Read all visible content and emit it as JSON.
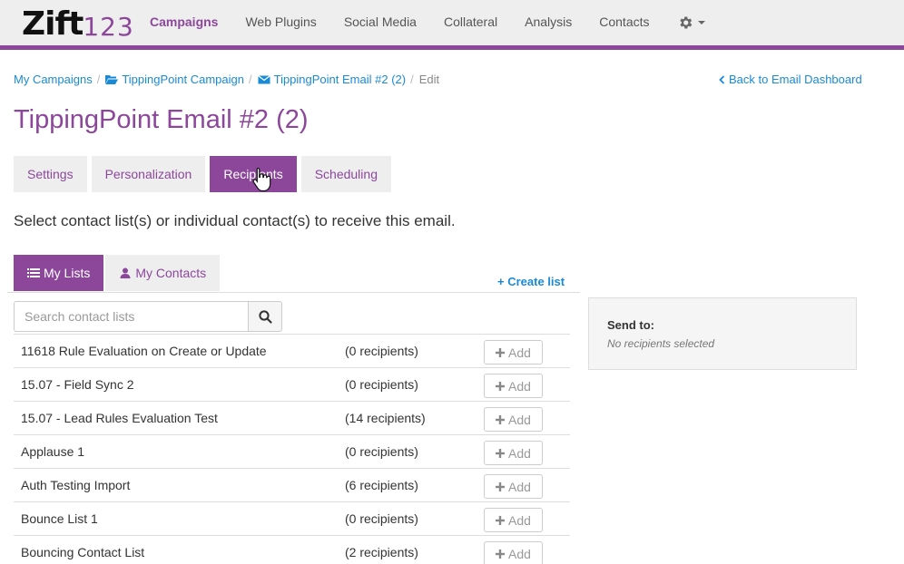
{
  "logo": {
    "main": "Zift",
    "number": "123"
  },
  "nav": {
    "items": [
      {
        "label": "Campaigns",
        "active": true
      },
      {
        "label": "Web Plugins",
        "active": false
      },
      {
        "label": "Social Media",
        "active": false
      },
      {
        "label": "Collateral",
        "active": false
      },
      {
        "label": "Analysis",
        "active": false
      },
      {
        "label": "Contacts",
        "active": false
      }
    ],
    "settings_icon": "gear-icon"
  },
  "breadcrumb": {
    "items": [
      {
        "label": "My Campaigns",
        "icon": null
      },
      {
        "label": "TippingPoint Campaign",
        "icon": "folder-open-icon"
      },
      {
        "label": "TippingPoint Email #2 (2)",
        "icon": "envelope-icon"
      }
    ],
    "current": "Edit"
  },
  "back_link": "Back to Email Dashboard",
  "page_title": "TippingPoint Email #2 (2)",
  "tabs": [
    {
      "label": "Settings",
      "active": false
    },
    {
      "label": "Personalization",
      "active": false
    },
    {
      "label": "Recipients",
      "active": true
    },
    {
      "label": "Scheduling",
      "active": false
    }
  ],
  "instructions": "Select contact list(s) or individual contact(s) to receive this email.",
  "subtabs": [
    {
      "label": "My Lists",
      "icon": "list-icon",
      "active": true
    },
    {
      "label": "My Contacts",
      "icon": "user-icon",
      "active": false
    }
  ],
  "create_list": "+ Create list",
  "search": {
    "placeholder": "Search contact lists",
    "value": ""
  },
  "add_label": "Add",
  "lists": [
    {
      "name": "11618 Rule Evaluation on Create or Update",
      "count": "(0 recipients)"
    },
    {
      "name": "15.07 - Field Sync 2",
      "count": "(0 recipients)"
    },
    {
      "name": "15.07 - Lead Rules Evaluation Test",
      "count": "(14 recipients)"
    },
    {
      "name": "Applause 1",
      "count": "(0 recipients)"
    },
    {
      "name": "Auth Testing Import",
      "count": "(6 recipients)"
    },
    {
      "name": "Bounce List 1",
      "count": "(0 recipients)"
    },
    {
      "name": "Bouncing Contact List",
      "count": "(2 recipients)"
    }
  ],
  "send_to": {
    "label": "Send to:",
    "empty_text": "No recipients selected"
  },
  "colors": {
    "brand": "#8c479b",
    "link": "#1a8ad4",
    "nav_bg": "#eeeeee"
  }
}
